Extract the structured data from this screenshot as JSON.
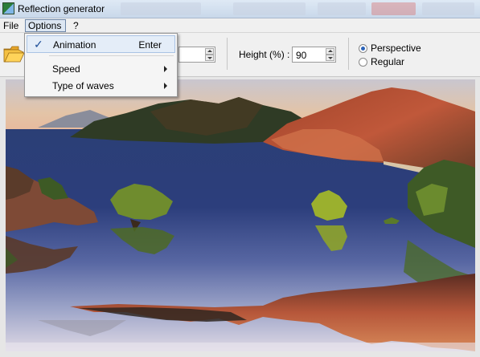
{
  "window": {
    "title": "Reflection generator"
  },
  "menubar": {
    "file": "File",
    "options": "Options",
    "help": "?"
  },
  "options_menu": {
    "animation": {
      "label": "Animation",
      "shortcut": "Enter",
      "checked": true
    },
    "speed": {
      "label": "Speed"
    },
    "type_of_waves": {
      "label": "Type of waves"
    }
  },
  "toolbar": {
    "height_label": "Height (%) :",
    "height_value": "90",
    "perspective_label": "Perspective",
    "regular_label": "Regular",
    "selected_mode": "Perspective"
  },
  "colors": {
    "accent": "#2b63b8",
    "menu_highlight": "#e4edf8"
  }
}
